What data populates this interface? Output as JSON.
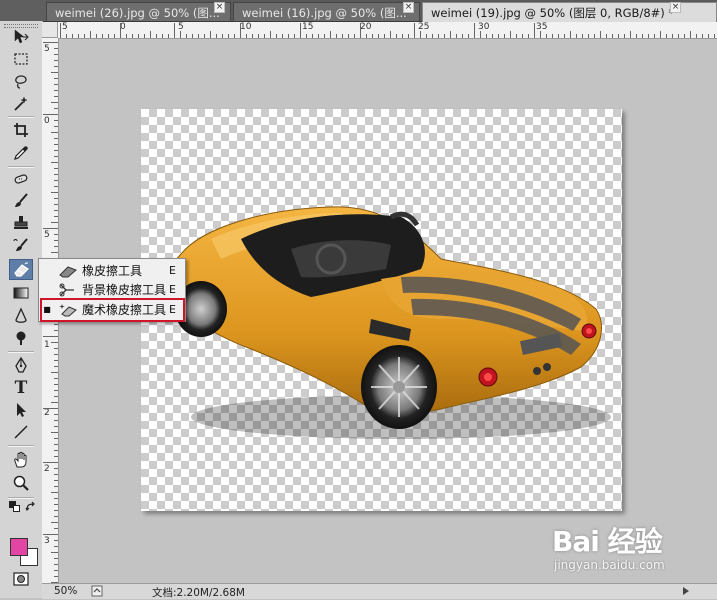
{
  "tabs": [
    {
      "label": "weimei (26).jpg @ 50% (图...",
      "active": false
    },
    {
      "label": "weimei (16).jpg @ 50% (图...",
      "active": false
    },
    {
      "label": "weimei (19).jpg @ 50% (图层 0, RGB/8#) *",
      "active": true
    }
  ],
  "tab_close_glyph": "×",
  "tools": [
    {
      "name": "move-tool",
      "icon": "move-arrow-icon"
    },
    {
      "name": "marquee-tool",
      "icon": "dashed-rectangle-icon"
    },
    {
      "name": "lasso-tool",
      "icon": "lasso-icon"
    },
    {
      "name": "quick-select-tool",
      "icon": "magic-wand-icon"
    },
    {
      "name": "crop-tool",
      "icon": "crop-icon"
    },
    {
      "name": "eyedropper-tool",
      "icon": "eyedropper-icon"
    },
    {
      "name": "healing-brush-tool",
      "icon": "bandage-icon"
    },
    {
      "name": "brush-tool",
      "icon": "brush-icon"
    },
    {
      "name": "clone-stamp-tool",
      "icon": "stamp-icon"
    },
    {
      "name": "history-brush-tool",
      "icon": "history-brush-icon"
    },
    {
      "name": "eraser-tool",
      "icon": "eraser-icon",
      "selected": true
    },
    {
      "name": "gradient-tool",
      "icon": "gradient-icon"
    },
    {
      "name": "blur-tool",
      "icon": "blur-drop-icon"
    },
    {
      "name": "dodge-tool",
      "icon": "dodge-icon"
    },
    {
      "name": "pen-tool",
      "icon": "pen-icon"
    },
    {
      "name": "type-tool",
      "icon": "type-icon"
    },
    {
      "name": "path-select-tool",
      "icon": "path-arrow-icon"
    },
    {
      "name": "line-tool",
      "icon": "line-icon"
    },
    {
      "name": "hand-tool",
      "icon": "hand-icon"
    },
    {
      "name": "zoom-tool",
      "icon": "zoom-icon"
    }
  ],
  "type_tool_glyph": "T",
  "colors": {
    "foreground": "#e245a4",
    "background": "#ffffff",
    "highlight": "#d0142a",
    "selected_tool": "#5e7ea8"
  },
  "ruler_top_numbers": [
    "5",
    "0",
    "5",
    "10",
    "15",
    "20",
    "25",
    "30",
    "35"
  ],
  "ruler_left_numbers": [
    "5",
    "0",
    "5",
    "1",
    "1",
    "2",
    "2",
    "3"
  ],
  "flyout": {
    "items": [
      {
        "label": "橡皮擦工具",
        "shortcut": "E",
        "icon": "eraser-icon",
        "current": false
      },
      {
        "label": "背景橡皮擦工具",
        "shortcut": "E",
        "icon": "background-eraser-icon",
        "current": false
      },
      {
        "label": "魔术橡皮擦工具",
        "shortcut": "E",
        "icon": "magic-eraser-icon",
        "current": true
      }
    ],
    "current_marker": "■"
  },
  "status": {
    "zoom": "50%",
    "doc_info": "文档:2.20M/2.68M"
  },
  "watermark": {
    "logo": "Bai 经验",
    "url": "jingyan.baidu.com"
  }
}
